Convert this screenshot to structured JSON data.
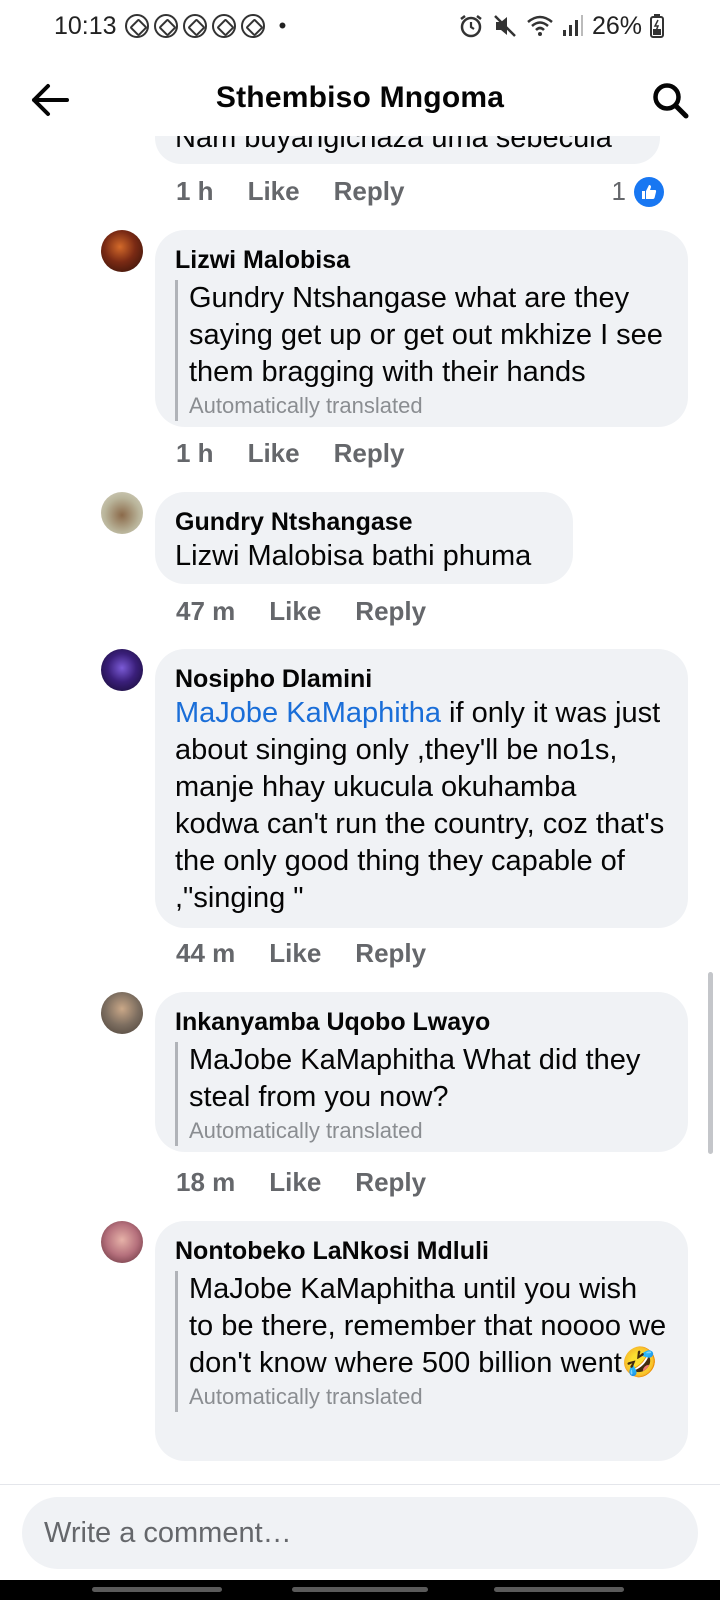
{
  "status_bar": {
    "time": "10:13",
    "battery": "26%",
    "icons": [
      "notification-icon",
      "alarm-icon",
      "mute-icon",
      "wifi-icon",
      "signal-icon",
      "battery-icon"
    ]
  },
  "header": {
    "title": "Sthembiso Mngoma",
    "back_icon": "back-arrow-icon",
    "search_icon": "search-icon"
  },
  "partial_comment": {
    "text": "Nam buyangichaza uma sebecula",
    "time": "1 h",
    "like_label": "Like",
    "reply_label": "Reply",
    "reaction_count": "1"
  },
  "comments": [
    {
      "author": "Lizwi Malobisa",
      "text": "Gundry Ntshangase what are they saying get up or get out mkhize I see them bragging with their hands",
      "translated_label": "Automatically translated",
      "time": "1 h",
      "like_label": "Like",
      "reply_label": "Reply",
      "avatar_color": "#5b2a1e"
    },
    {
      "author": "Gundry Ntshangase",
      "text": "Lizwi Malobisa bathi phuma",
      "time": "47 m",
      "like_label": "Like",
      "reply_label": "Reply",
      "avatar_color": "#a4a087"
    },
    {
      "author": "Nosipho Dlamini",
      "mention": "MaJobe KaMaphitha",
      "text": " if only it was just about singing only ,they'll be no1s,  manje hhay ukucula okuhamba kodwa can't run the country,  coz that's the only good thing they capable of ,\"singing \"",
      "time": "44 m",
      "like_label": "Like",
      "reply_label": "Reply",
      "avatar_color": "#2a1a55"
    },
    {
      "author": "Inkanyamba Uqobo Lwayo",
      "text": "MaJobe KaMaphitha What did they steal from you now?",
      "translated_label": "Automatically translated",
      "time": "18 m",
      "like_label": "Like",
      "reply_label": "Reply",
      "avatar_color": "#6e6256"
    },
    {
      "author": "Nontobeko LaNkosi Mdluli",
      "text": "MaJobe KaMaphitha until you wish to be there, remember that noooo we don't know where 500 billion went",
      "emoji": "🤣",
      "translated_label": "Automatically translated",
      "avatar_color": "#b5707c"
    }
  ],
  "composer": {
    "placeholder": "Write a comment…"
  },
  "colors": {
    "bubble": "#f0f2f5",
    "mention": "#1a6ed8",
    "meta": "#65676b",
    "like_blue": "#1877f2"
  }
}
